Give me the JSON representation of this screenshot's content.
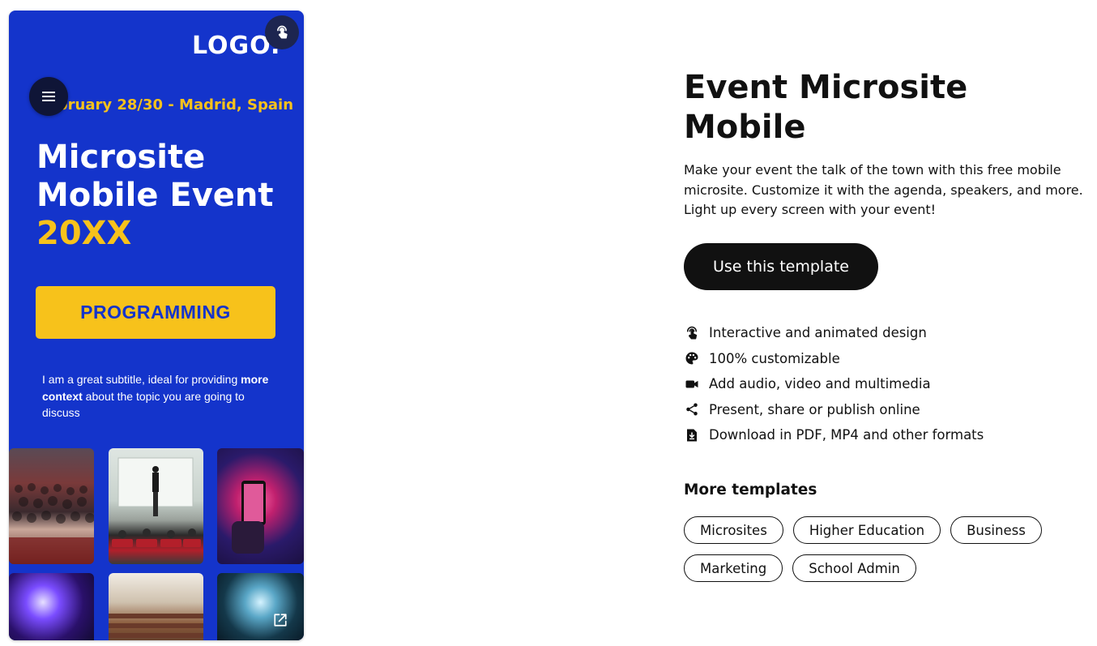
{
  "preview": {
    "logo": "LOGO.",
    "date_line": "February 28/30 - Madrid, Spain",
    "hero_title_line1": "Microsite",
    "hero_title_line2": "Mobile Event",
    "hero_title_accent": "20XX",
    "programming_button": "PROGRAMMING",
    "subtitle_part1": "I am a great subtitle, ideal for providing ",
    "subtitle_bold": "more context",
    "subtitle_part2": " about the topic you are going to discuss",
    "icons": {
      "touch": "touch-icon",
      "menu": "hamburger-menu-icon",
      "external_link": "external-link-icon"
    },
    "colors": {
      "background": "#1434cb",
      "accent": "#f7c21b"
    }
  },
  "info": {
    "title": "Event Microsite Mobile",
    "description": "Make your event the talk of the town with this free mobile microsite. Customize it with the agenda, speakers, and more. Light up every screen with your event!",
    "cta_label": "Use this template",
    "features": [
      {
        "icon": "touch-icon",
        "label": "Interactive and animated design"
      },
      {
        "icon": "palette-icon",
        "label": "100% customizable"
      },
      {
        "icon": "video-camera-icon",
        "label": "Add audio, video and multimedia"
      },
      {
        "icon": "share-icon",
        "label": "Present, share or publish online"
      },
      {
        "icon": "download-icon",
        "label": "Download in PDF, MP4 and other formats"
      }
    ],
    "more_templates_title": "More templates",
    "tags": [
      "Microsites",
      "Higher Education",
      "Business",
      "Marketing",
      "School Admin"
    ]
  }
}
